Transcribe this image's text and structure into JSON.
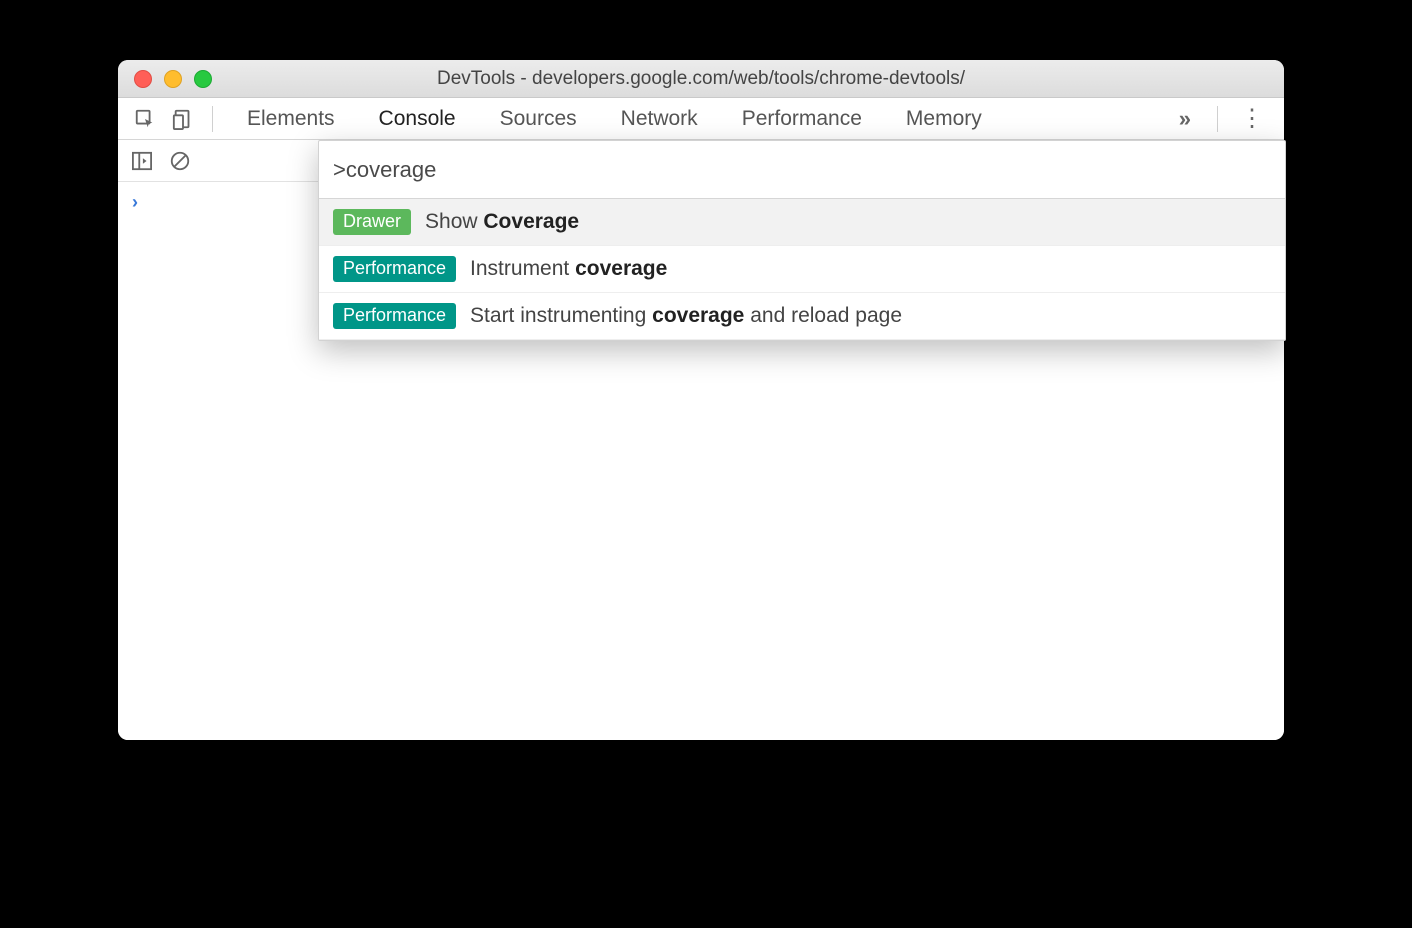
{
  "window": {
    "title": "DevTools - developers.google.com/web/tools/chrome-devtools/"
  },
  "tabs": {
    "items": [
      "Elements",
      "Console",
      "Sources",
      "Network",
      "Performance",
      "Memory"
    ],
    "active": "Console",
    "overflow_glyph": "»",
    "kebab_glyph": "⋮"
  },
  "command": {
    "input_value": ">coverage",
    "items": [
      {
        "badge": "Drawer",
        "badge_kind": "drawer",
        "text_prefix": "Show ",
        "text_bold": "Coverage",
        "text_suffix": "",
        "selected": true
      },
      {
        "badge": "Performance",
        "badge_kind": "performance",
        "text_prefix": "Instrument ",
        "text_bold": "coverage",
        "text_suffix": "",
        "selected": false
      },
      {
        "badge": "Performance",
        "badge_kind": "performance",
        "text_prefix": "Start instrumenting ",
        "text_bold": "coverage",
        "text_suffix": " and reload page",
        "selected": false
      }
    ]
  },
  "console": {
    "prompt_glyph": "›"
  }
}
